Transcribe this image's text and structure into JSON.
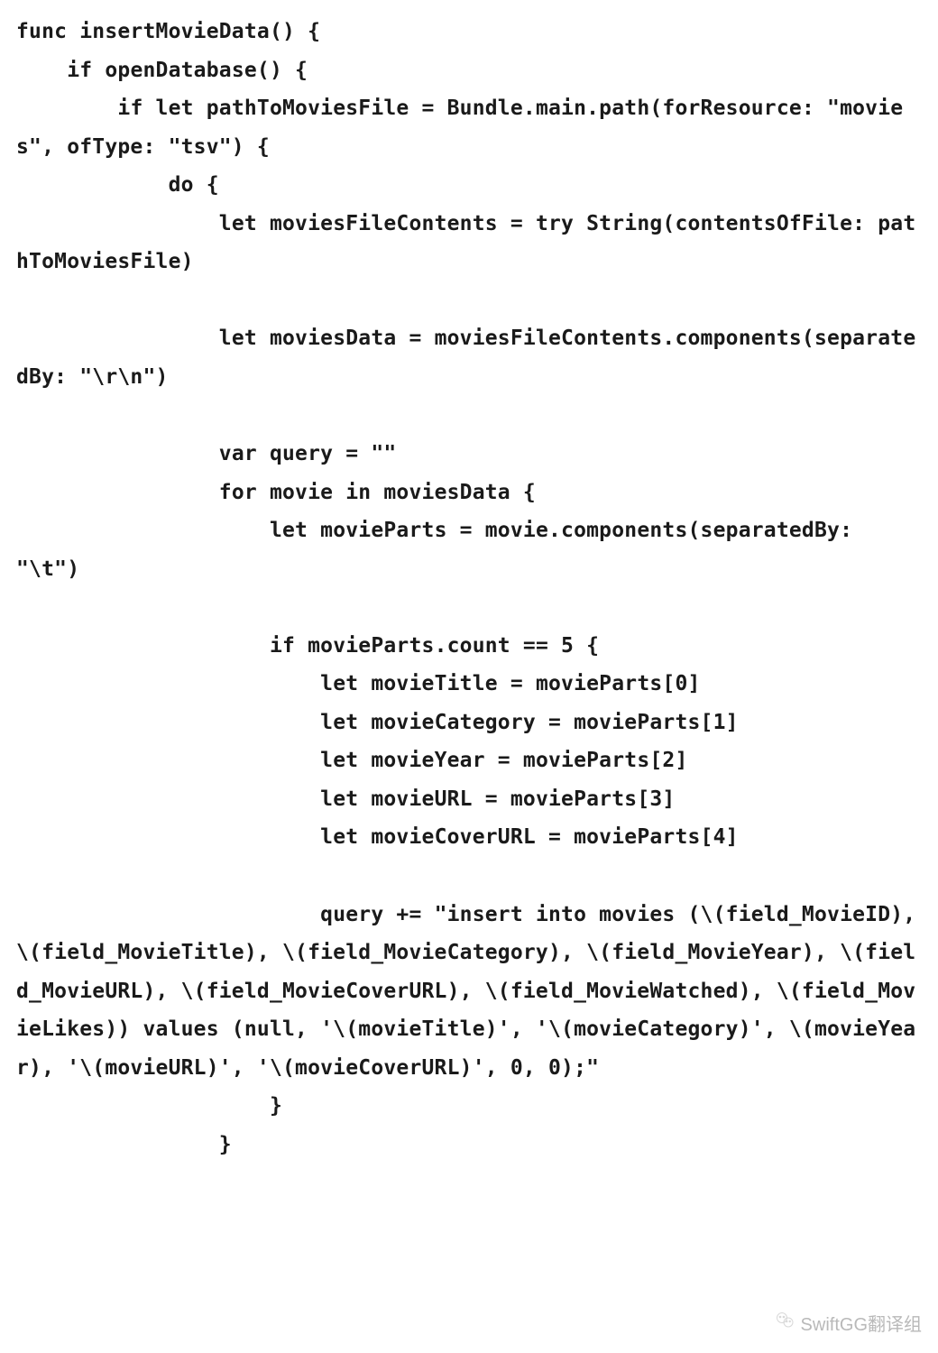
{
  "code": "func insertMovieData() {\n    if openDatabase() {\n        if let pathToMoviesFile = Bundle.main.path(forResource: \"movies\", ofType: \"tsv\") {\n            do {\n                let moviesFileContents = try String(contentsOfFile: pathToMoviesFile)\n\n                let moviesData = moviesFileContents.components(separatedBy: \"\\r\\n\")\n\n                var query = \"\"\n                for movie in moviesData {\n                    let movieParts = movie.components(separatedBy: \"\\t\")\n\n                    if movieParts.count == 5 {\n                        let movieTitle = movieParts[0]\n                        let movieCategory = movieParts[1]\n                        let movieYear = movieParts[2]\n                        let movieURL = movieParts[3]\n                        let movieCoverURL = movieParts[4]\n\n                        query += \"insert into movies (\\(field_MovieID), \\(field_MovieTitle), \\(field_MovieCategory), \\(field_MovieYear), \\(field_MovieURL), \\(field_MovieCoverURL), \\(field_MovieWatched), \\(field_MovieLikes)) values (null, '\\(movieTitle)', '\\(movieCategory)', \\(movieYear), '\\(movieURL)', '\\(movieCoverURL)', 0, 0);\"\n                    }\n                }",
  "watermark": {
    "label": "SwiftGG翻译组"
  }
}
